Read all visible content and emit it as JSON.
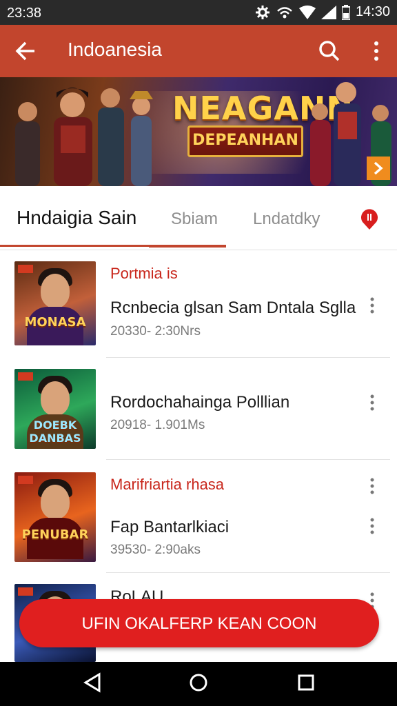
{
  "status_bar": {
    "time_left": "23:38",
    "time_right": "14:30",
    "icons": [
      "gear-icon",
      "wifi-calling-icon",
      "wifi-icon",
      "signal-icon",
      "battery-icon"
    ]
  },
  "app_bar": {
    "title": "Indoanesia",
    "back_icon": "back-arrow-icon",
    "search_icon": "search-icon",
    "more_icon": "more-vert-icon"
  },
  "banner": {
    "title": "NEAGANN",
    "subtitle": "DEPEANHAN",
    "next_icon": "chevron-right-icon"
  },
  "tabs": [
    {
      "label": "Hndaigia Sain",
      "active": true
    },
    {
      "label": "Sbiam",
      "active": false
    },
    {
      "label": "Lndatdky",
      "active": false
    }
  ],
  "tab_badge_icon": "notification-badge-icon",
  "list": [
    {
      "kicker": "Portmia is",
      "title": "Rcnbecia glsan Sam Dntala Sglla",
      "meta": "20330- 2:30Nrs",
      "thumb_title": "MONASA",
      "thumb_palette": [
        "#5a2a12",
        "#c2603a",
        "#2b2a6b"
      ]
    },
    {
      "kicker": "",
      "title": "Rordochahainga Polllian",
      "meta": "20918- 1.901Ms",
      "thumb_title": "DOEBK DANBAS",
      "thumb_palette": [
        "#0b5a3a",
        "#2ea85a",
        "#0d3a2a"
      ]
    },
    {
      "kicker": "Marifriartia rhasa",
      "title": "Fap Bantarlkiaci",
      "meta": "39530- 2:90aks",
      "thumb_title": "PENUBAR",
      "thumb_palette": [
        "#8a1a10",
        "#e8641e",
        "#3a1a40"
      ]
    },
    {
      "kicker": "",
      "title": "RoLAU",
      "meta": "",
      "thumb_title": "",
      "thumb_palette": [
        "#10204a",
        "#3a5ab8",
        "#0a1230"
      ]
    }
  ],
  "more_item_icon": "more-vert-icon",
  "cta": {
    "label": "UFIN OKALFERP KEAN COON"
  },
  "nav_bar": [
    "back-triangle-icon",
    "home-circle-icon",
    "recents-square-icon"
  ],
  "colors": {
    "primary": "#c2452d",
    "accent_red": "#e01f1f",
    "kicker_red": "#c8261b"
  }
}
